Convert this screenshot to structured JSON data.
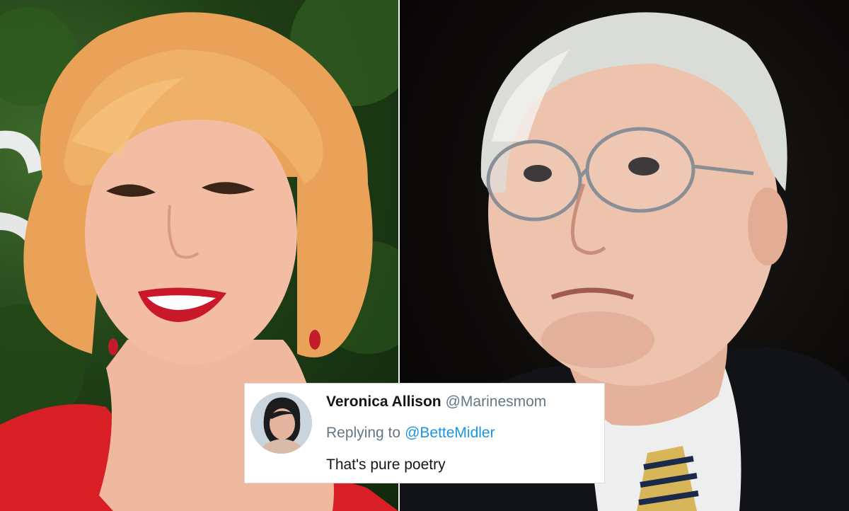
{
  "tweet": {
    "name": "Veronica Allison",
    "handle": "@Marinesmom",
    "reply_prefix": "Replying to",
    "reply_handle": "@BetteMidler",
    "text": "That's pure poetry"
  },
  "colors": {
    "link": "#1b95e0",
    "muted": "#657786",
    "text": "#14171a",
    "card_bg": "#ffffff"
  }
}
